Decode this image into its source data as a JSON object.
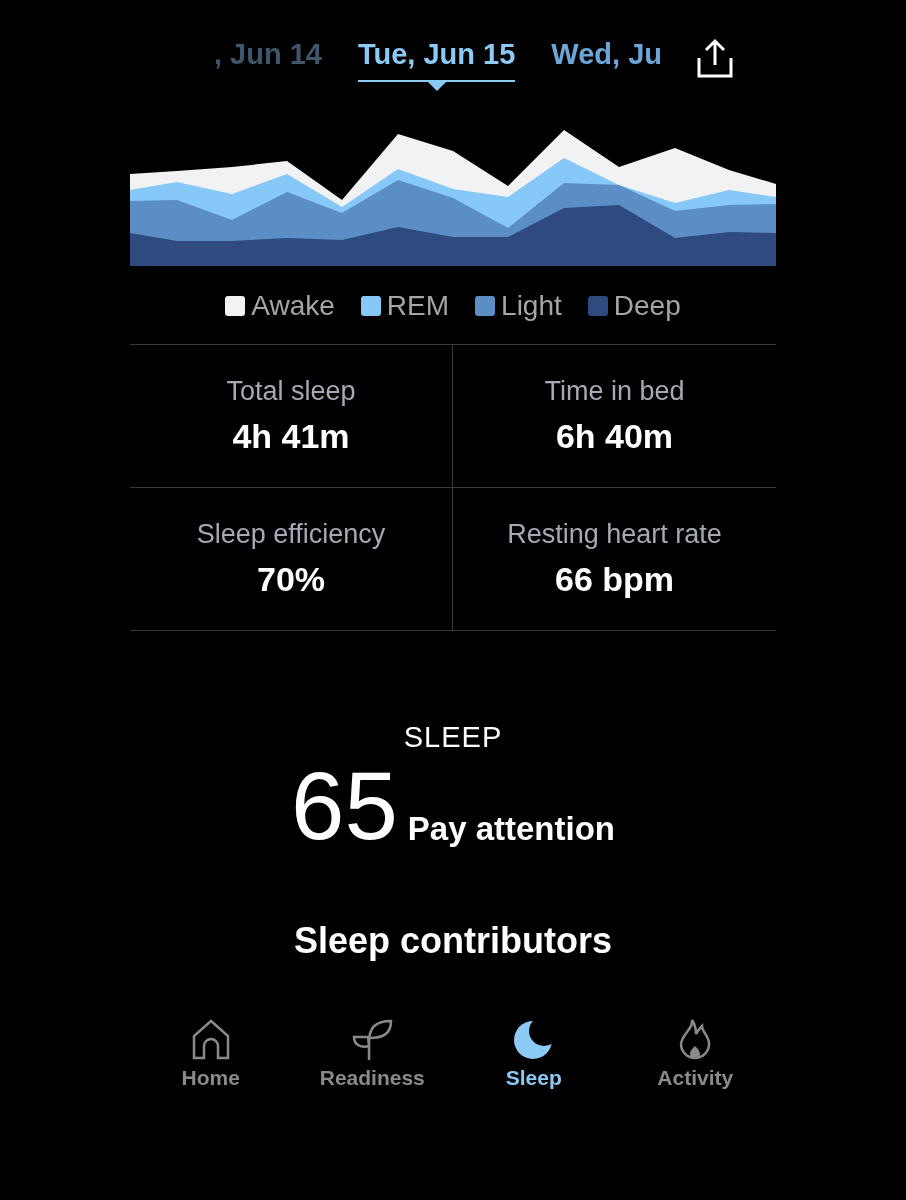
{
  "date_tabs": [
    {
      "label": ", Jun 14",
      "selected": false
    },
    {
      "label": "Tue, Jun 15",
      "selected": true
    },
    {
      "label": "Wed, Ju",
      "selected": false
    }
  ],
  "legend": [
    {
      "label": "Awake",
      "color": "#f1f2f4"
    },
    {
      "label": "REM",
      "color": "#86c8f8"
    },
    {
      "label": "Light",
      "color": "#5b8ec4"
    },
    {
      "label": "Deep",
      "color": "#2e4a7e"
    }
  ],
  "stats": [
    {
      "title": "Total sleep",
      "value": "4h 41m"
    },
    {
      "title": "Time in bed",
      "value": "6h 40m"
    },
    {
      "title": "Sleep efficiency",
      "value": "70%"
    },
    {
      "title": "Resting heart rate",
      "value": "66 bpm"
    }
  ],
  "score": {
    "heading": "SLEEP",
    "value": "65",
    "rating": "Pay attention"
  },
  "section_title": "Sleep contributors",
  "nav": [
    {
      "label": "Home",
      "kind": "home",
      "selected": false
    },
    {
      "label": "Readiness",
      "kind": "readiness",
      "selected": false
    },
    {
      "label": "Sleep",
      "kind": "sleep",
      "selected": true
    },
    {
      "label": "Activity",
      "kind": "activity",
      "selected": false
    }
  ]
}
